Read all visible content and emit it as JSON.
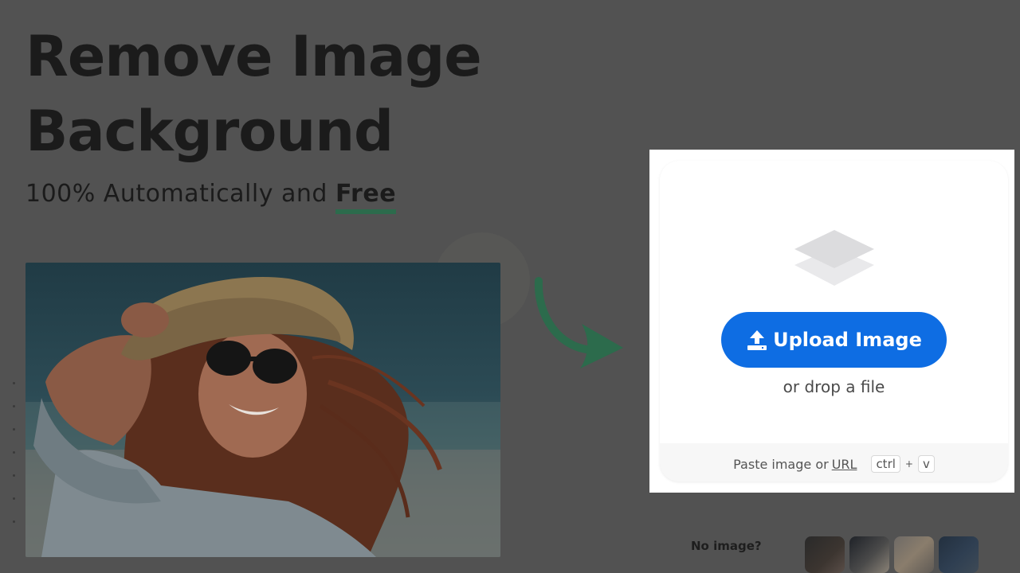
{
  "hero": {
    "title_line1": "Remove Image",
    "title_line2": "Background",
    "subtitle_prefix": "100% Automatically and ",
    "subtitle_emphasis": "Free"
  },
  "uploader": {
    "upload_button_label": "Upload Image",
    "drop_text": "or drop a file",
    "paste_prefix": "Paste image or",
    "paste_link": "URL",
    "shortcut_key1": "ctrl",
    "shortcut_plus": "+",
    "shortcut_key2": "v"
  },
  "samples": {
    "label": "No image?"
  },
  "colors": {
    "primary_button": "#0e6de3",
    "underline_accent": "#2c6b4c",
    "overlay": "#525252"
  }
}
